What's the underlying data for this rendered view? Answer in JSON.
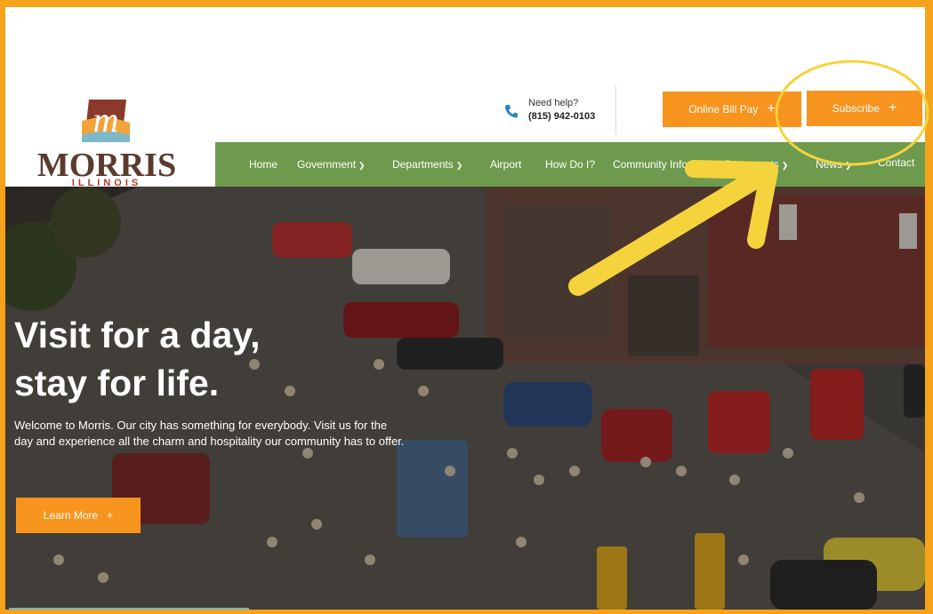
{
  "header": {
    "logo": {
      "name": "MORRIS",
      "sub": "ILLINOIS"
    },
    "help": {
      "label": "Need help?",
      "phone": "(815) 942-0103"
    },
    "buttons": {
      "bill_pay": "Online Bill Pay",
      "subscribe": "Subscribe"
    }
  },
  "nav": {
    "items": [
      {
        "label": "Home",
        "dropdown": false
      },
      {
        "label": "Government",
        "dropdown": true
      },
      {
        "label": "Departments",
        "dropdown": true
      },
      {
        "label": "Airport",
        "dropdown": false
      },
      {
        "label": "How Do I?",
        "dropdown": false
      },
      {
        "label": "Community Info",
        "dropdown": true
      },
      {
        "label": "Documents",
        "dropdown": true
      },
      {
        "label": "News",
        "dropdown": true
      },
      {
        "label": "Contact",
        "dropdown": false
      }
    ]
  },
  "hero": {
    "title_line1": "Visit for a day,",
    "title_line2": "stay for life.",
    "text": "Welcome to Morris. Our city has something for everybody. Visit us for the day and experience all the charm and hospitality our community has to offer.",
    "button": "Learn More"
  },
  "colors": {
    "accent": "#f7941d",
    "nav": "#6e9a4e",
    "frame": "#f7a21b",
    "annotation": "#f5d33c"
  },
  "icons": {
    "phone": "phone-icon",
    "plus": "plus-icon",
    "caret": "chevron-down-icon"
  }
}
